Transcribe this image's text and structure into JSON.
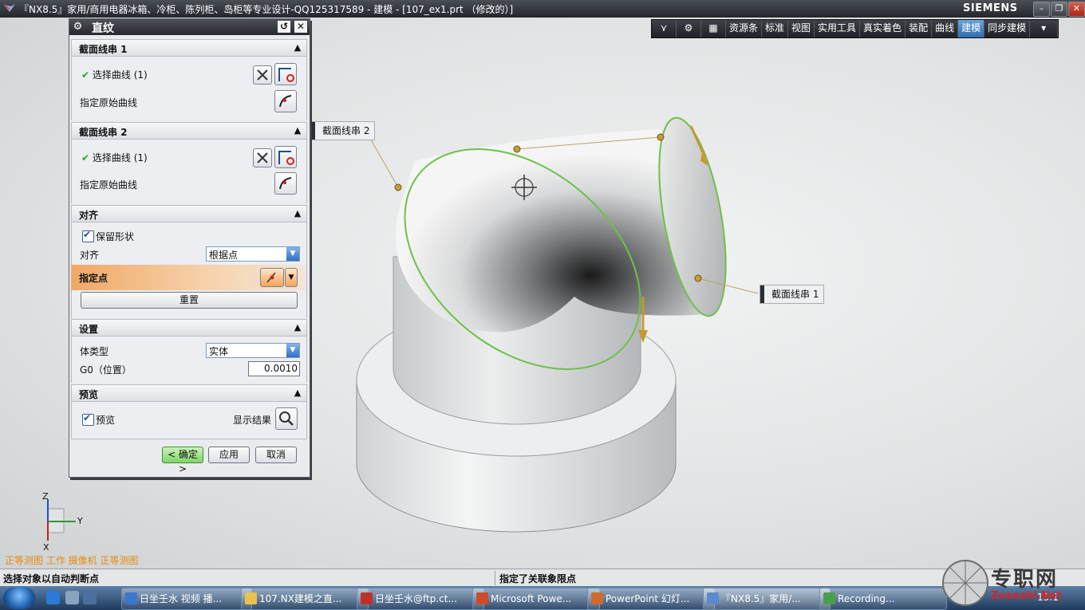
{
  "titlebar": {
    "title": "『NX8.5』家用/商用电器冰箱、冷柜、陈列柜、岛柜等专业设计-QQ125317589 - 建模 - [107_ex1.prt （修改的）]",
    "brand": "SIEMENS"
  },
  "ribbon": {
    "items": [
      "资源条",
      "标准",
      "视图",
      "实用工具",
      "真实着色",
      "装配",
      "曲线",
      "建模",
      "同步建模"
    ],
    "active": "建模"
  },
  "dialog": {
    "title": "直纹",
    "section1": {
      "title": "截面线串 1",
      "select_curve": "选择曲线 (1)",
      "origin_curve": "指定原始曲线"
    },
    "section2": {
      "title": "截面线串 2",
      "select_curve": "选择曲线 (1)",
      "origin_curve": "指定原始曲线"
    },
    "align": {
      "title": "对齐",
      "keep_shape": "保留形状",
      "align_label": "对齐",
      "align_value": "根据点",
      "specify_point": "指定点",
      "reset": "重置"
    },
    "settings": {
      "title": "设置",
      "body_type_label": "体类型",
      "body_type_value": "实体",
      "g0_label": "G0（位置）",
      "g0_value": "0.0010"
    },
    "preview": {
      "title": "预览",
      "preview_label": "预览",
      "show_result": "显示结果"
    },
    "buttons": {
      "ok": "< 确定 >",
      "apply": "应用",
      "cancel": "取消"
    }
  },
  "viewport": {
    "callout1": "截面线串 2",
    "callout2": "截面线串 1",
    "view_name": "正等测图 工作 摄像机 正等测图",
    "axis_x": "X",
    "axis_y": "Y",
    "axis_z": "Z"
  },
  "status": {
    "left": "选择对象以自动判断点",
    "right": "指定了关联象限点"
  },
  "taskbar": {
    "tasks": [
      "日坐壬水 视频 播...",
      "107.NX建模之直...",
      "日坐壬水@ftp.ct...",
      "Microsoft Powe...",
      "PowerPoint 幻灯...",
      "『NX8.5』家用/...",
      "Recording..."
    ],
    "clock": "13:1"
  },
  "watermark": {
    "zh": "专职网",
    "en": "Zuanzhi.Net"
  }
}
